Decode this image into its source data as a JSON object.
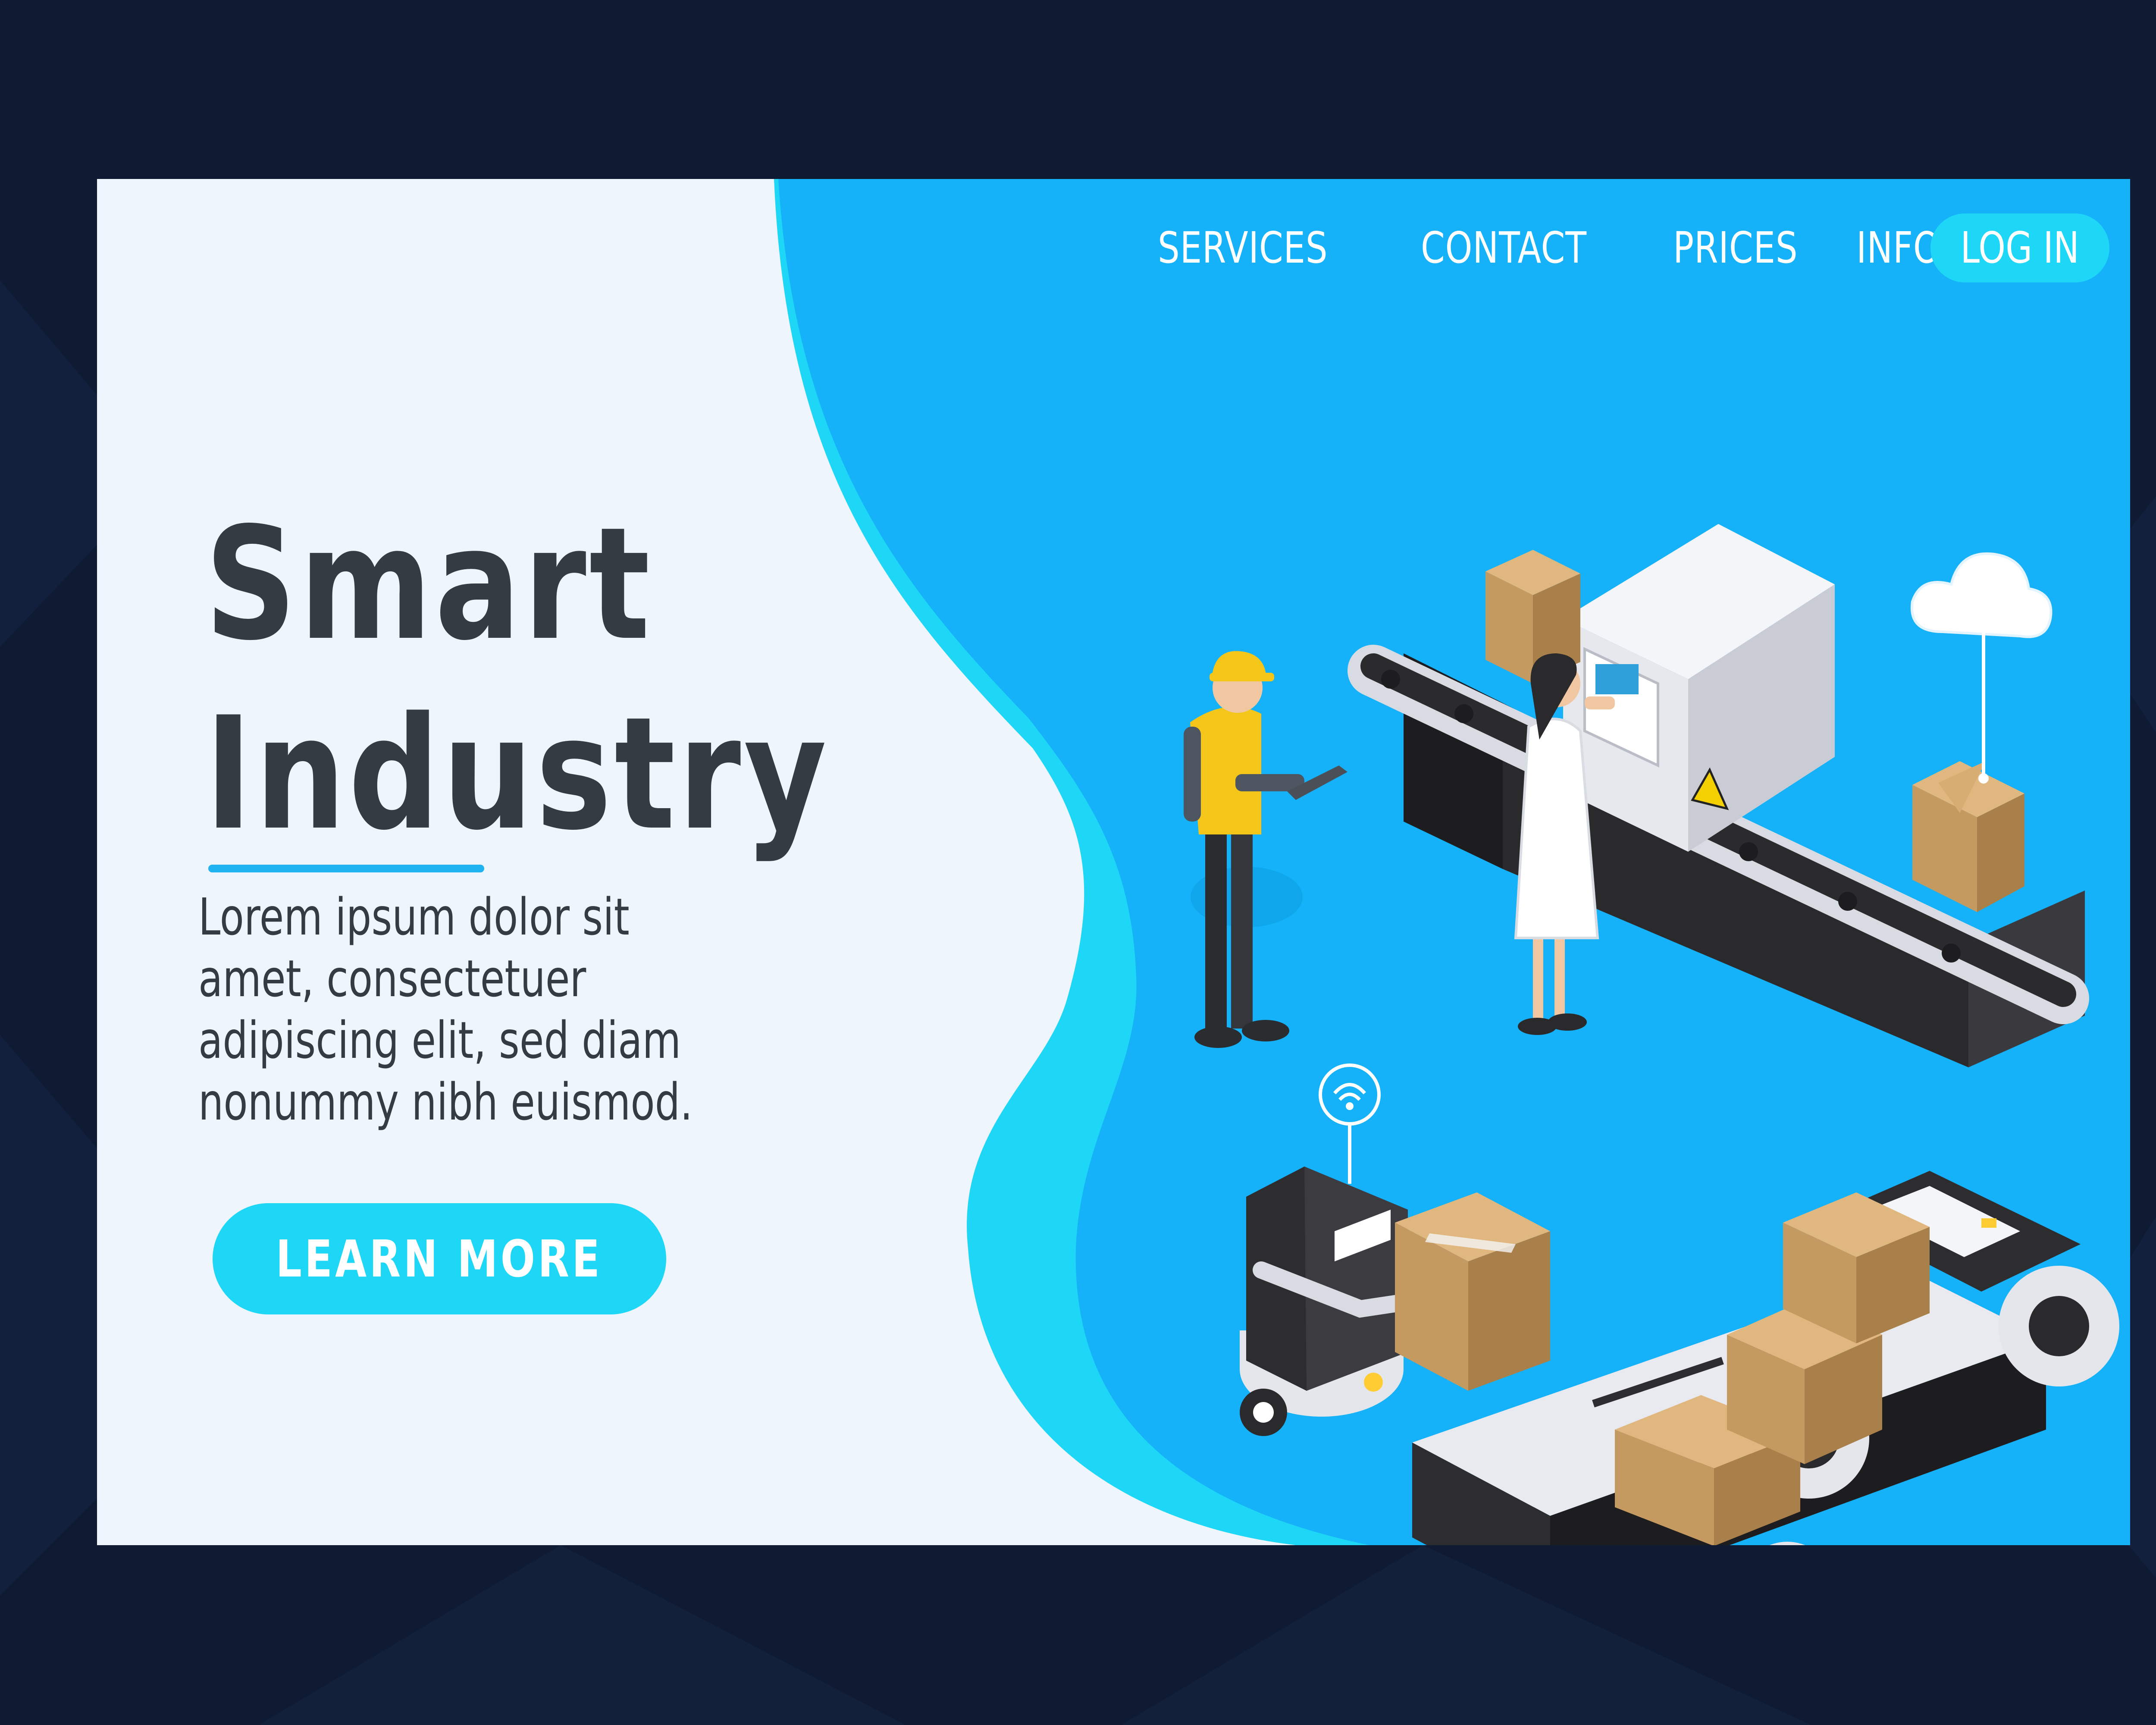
{
  "nav": {
    "items": [
      {
        "label": "SERVICES"
      },
      {
        "label": "CONTACT"
      },
      {
        "label": "PRICES"
      },
      {
        "label": "INFO"
      }
    ],
    "login_label": "LOG IN"
  },
  "hero": {
    "title_line1": "Smart",
    "title_line2": "Industry",
    "body": "Lorem ipsum dolor sit amet, consectetuer adipiscing elit, sed diam nonummy nibh euismod.",
    "cta_label": "LEARN MORE"
  },
  "illustration": {
    "scene": [
      "worker-icon",
      "scientist-icon",
      "conveyor-machine-icon",
      "cloud-icon",
      "wifi-icon",
      "robot-icon",
      "cargo-vehicle-icon",
      "box-icon"
    ]
  },
  "colors": {
    "page_background": "#0f1a33",
    "panel": "#eef5fc",
    "blue_area": "#15b2f9",
    "accent_cyan": "#1ed7f6",
    "title_text": "#353b42"
  }
}
